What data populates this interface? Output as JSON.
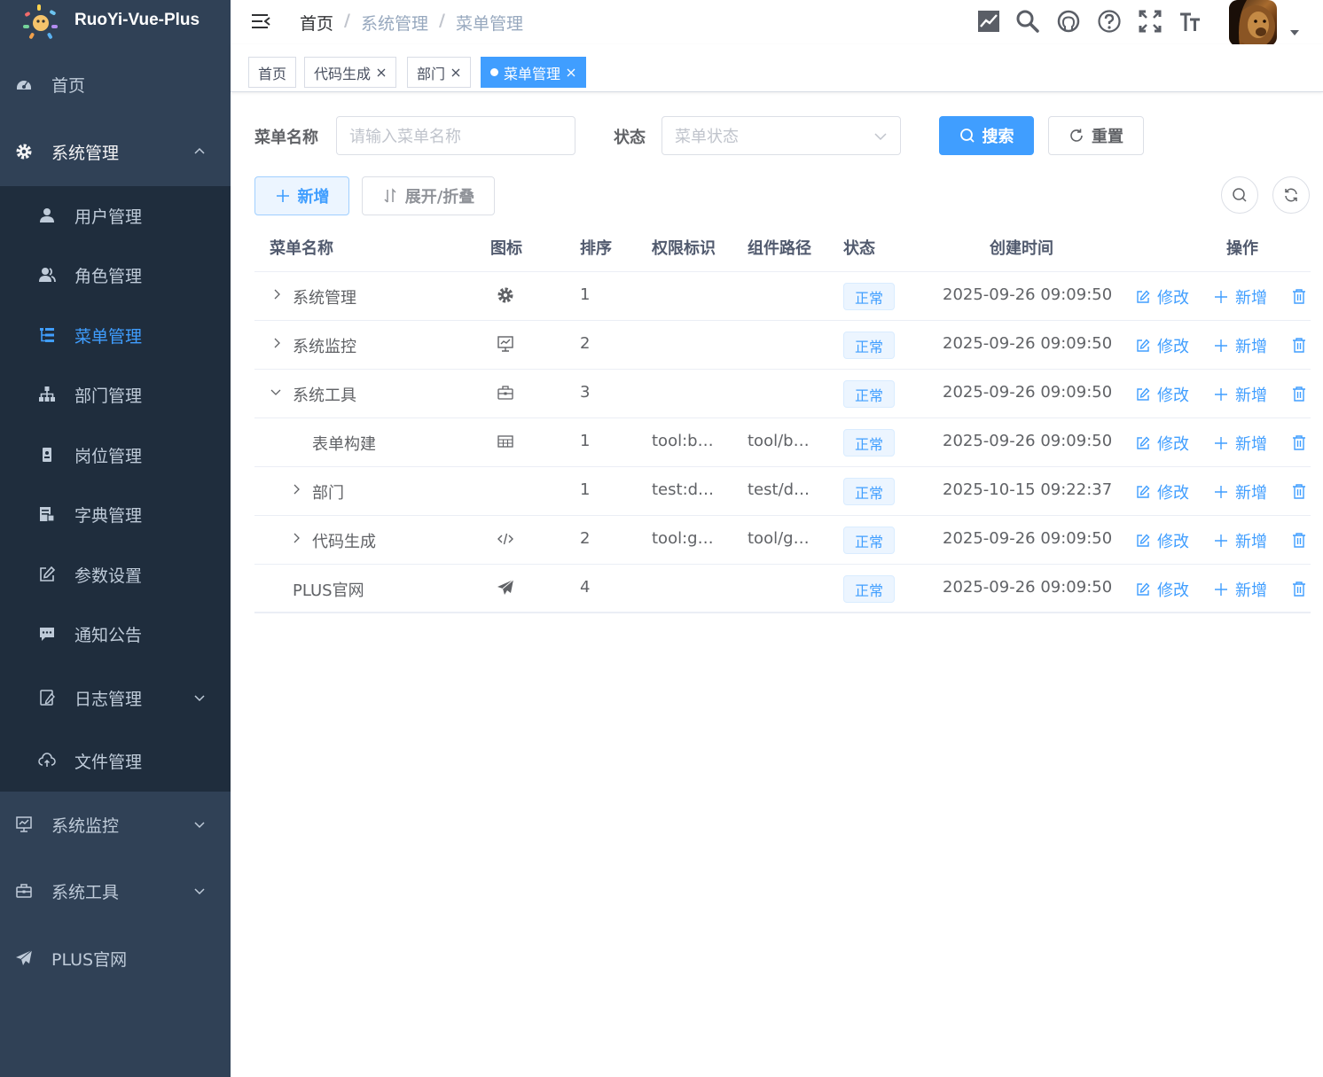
{
  "app": {
    "title": "RuoYi-Vue-Plus"
  },
  "sidebar": {
    "home": "首页",
    "system": "系统管理",
    "submenu": [
      {
        "label": "用户管理",
        "icon": "user-icon"
      },
      {
        "label": "角色管理",
        "icon": "peoples-icon"
      },
      {
        "label": "菜单管理",
        "icon": "tree-table-icon",
        "active": true
      },
      {
        "label": "部门管理",
        "icon": "tree-icon"
      },
      {
        "label": "岗位管理",
        "icon": "post-icon"
      },
      {
        "label": "字典管理",
        "icon": "dict-icon"
      },
      {
        "label": "参数设置",
        "icon": "edit-icon"
      },
      {
        "label": "通知公告",
        "icon": "message-icon"
      },
      {
        "label": "日志管理",
        "icon": "log-icon"
      },
      {
        "label": "文件管理",
        "icon": "upload-icon"
      }
    ],
    "monitor": "系统监控",
    "tool": "系统工具",
    "plus": "PLUS官网"
  },
  "breadcrumb": [
    "首页",
    "系统管理",
    "菜单管理"
  ],
  "tags": [
    "首页",
    "代码生成",
    "部门",
    "菜单管理"
  ],
  "search": {
    "name_label": "菜单名称",
    "name_placeholder": "请输入菜单名称",
    "status_label": "状态",
    "status_placeholder": "菜单状态",
    "search_btn": "搜索",
    "reset_btn": "重置"
  },
  "toolbar": {
    "add": "新增",
    "toggle": "展开/折叠"
  },
  "table": {
    "headers": [
      "菜单名称",
      "图标",
      "排序",
      "权限标识",
      "组件路径",
      "状态",
      "创建时间",
      "操作"
    ],
    "rows": [
      {
        "name": "系统管理",
        "icon": "system-icon",
        "order": "1",
        "perms": "",
        "component": "",
        "status": "正常",
        "created": "2025-09-26 09:09:50"
      },
      {
        "name": "系统监控",
        "icon": "monitor-icon",
        "order": "2",
        "perms": "",
        "component": "",
        "status": "正常",
        "created": "2025-09-26 09:09:50"
      },
      {
        "name": "系统工具",
        "icon": "tool-icon",
        "order": "3",
        "perms": "",
        "component": "",
        "status": "正常",
        "created": "2025-09-26 09:09:50"
      },
      {
        "name": "表单构建",
        "icon": "build-icon",
        "order": "1",
        "perms": "tool:b…",
        "component": "tool/b…",
        "status": "正常",
        "created": "2025-09-26 09:09:50"
      },
      {
        "name": "部门",
        "icon": "",
        "order": "1",
        "perms": "test:d…",
        "component": "test/d…",
        "status": "正常",
        "created": "2025-10-15 09:22:37"
      },
      {
        "name": "代码生成",
        "icon": "code-icon",
        "order": "2",
        "perms": "tool:g…",
        "component": "tool/g…",
        "status": "正常",
        "created": "2025-09-26 09:09:50"
      },
      {
        "name": "PLUS官网",
        "icon": "guide-icon",
        "order": "4",
        "perms": "",
        "component": "",
        "status": "正常",
        "created": "2025-09-26 09:09:50"
      }
    ],
    "op_edit": "修改",
    "op_add": "新增"
  },
  "colors": {
    "sidebar": "#304156",
    "submenu": "#1f2d3d",
    "primary": "#409eff"
  }
}
